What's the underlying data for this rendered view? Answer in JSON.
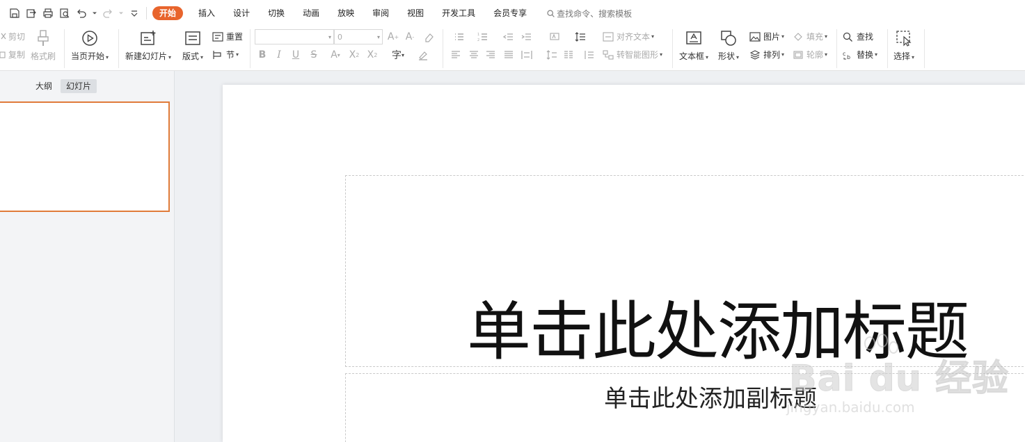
{
  "quick_access": {
    "icons": [
      "save-icon",
      "export-icon",
      "print-icon",
      "print-preview-icon",
      "undo-icon",
      "undo-dropdown",
      "redo-icon",
      "customize-icon"
    ]
  },
  "menu": {
    "tabs": [
      {
        "label": "开始",
        "active": true
      },
      {
        "label": "插入"
      },
      {
        "label": "设计"
      },
      {
        "label": "切换"
      },
      {
        "label": "动画"
      },
      {
        "label": "放映"
      },
      {
        "label": "审阅"
      },
      {
        "label": "视图"
      },
      {
        "label": "开发工具"
      },
      {
        "label": "会员专享"
      }
    ],
    "search_label": "查找命令、搜索模板"
  },
  "ribbon": {
    "cut_label": "剪切",
    "copy_label": "复制",
    "format_painter_label": "格式刷",
    "start_from_current_label": "当页开始",
    "new_slide_label": "新建幻灯片",
    "layout_label": "版式",
    "reset_label": "重置",
    "section_label": "节",
    "font_name_value": "",
    "font_size_value": "0",
    "align_text_label": "对齐文本",
    "smartart_label": "转智能图形",
    "textbox_label": "文本框",
    "shape_label": "形状",
    "picture_label": "图片",
    "arrange_label": "排列",
    "fill_label": "填充",
    "outline_label": "轮廓",
    "find_label": "查找",
    "replace_label": "替换",
    "select_label": "选择"
  },
  "left_pane": {
    "tabs": [
      {
        "label": "大纲"
      },
      {
        "label": "幻灯片",
        "active": true
      }
    ]
  },
  "slide": {
    "title_placeholder": "单击此处添加标题",
    "subtitle_placeholder": "单击此处添加副标题"
  },
  "watermark": {
    "logo_text": "Bai du 经验",
    "url": "jingyan.baidu.com"
  },
  "colors": {
    "accent": "#e8642c",
    "thumbnail_border": "#e07b39"
  }
}
